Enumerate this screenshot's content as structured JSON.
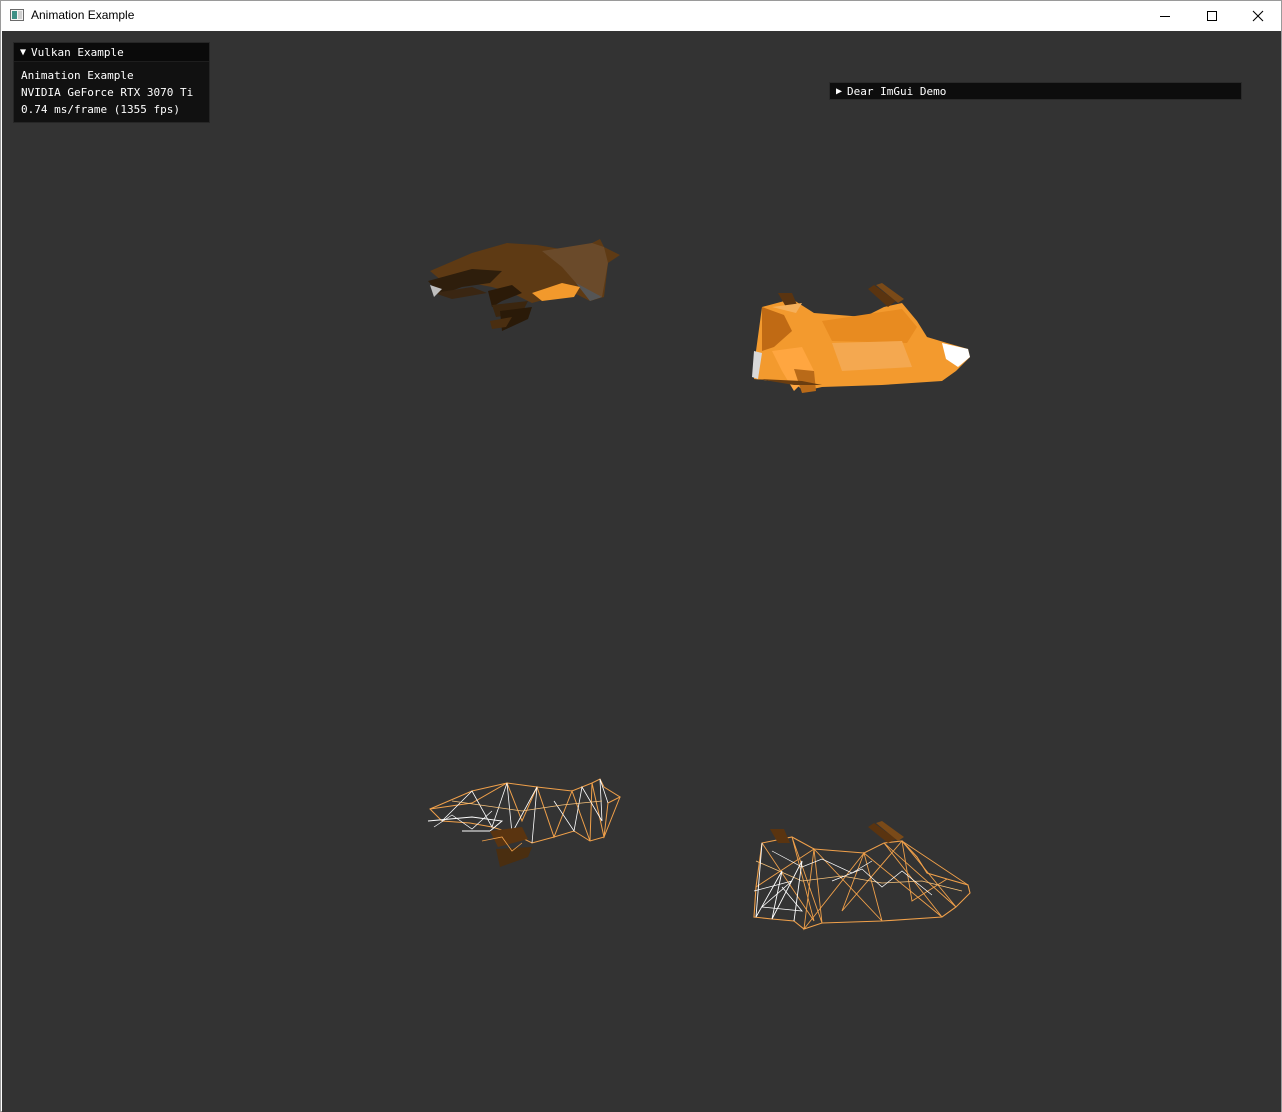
{
  "window": {
    "title": "Animation Example",
    "icon": "app-window-icon",
    "controls": [
      "minimize-icon",
      "maximize-icon",
      "close-icon"
    ]
  },
  "imgui_panel": {
    "header": "Vulkan Example",
    "lines": [
      "Animation Example",
      "NVIDIA GeForce RTX 3070 Ti",
      "0.74 ms/frame (1355 fps)"
    ]
  },
  "demo_window": {
    "label": "Dear ImGui Demo",
    "collapsed": true
  },
  "viewport": {
    "background": "#333333",
    "models": [
      "fox-shaded",
      "fox-shaded",
      "fox-wireframe",
      "fox-wireframe"
    ]
  },
  "colors": {
    "fox_orange": "#f39a2e",
    "fox_dark": "#5a3410",
    "wire": "#f0a04a"
  }
}
